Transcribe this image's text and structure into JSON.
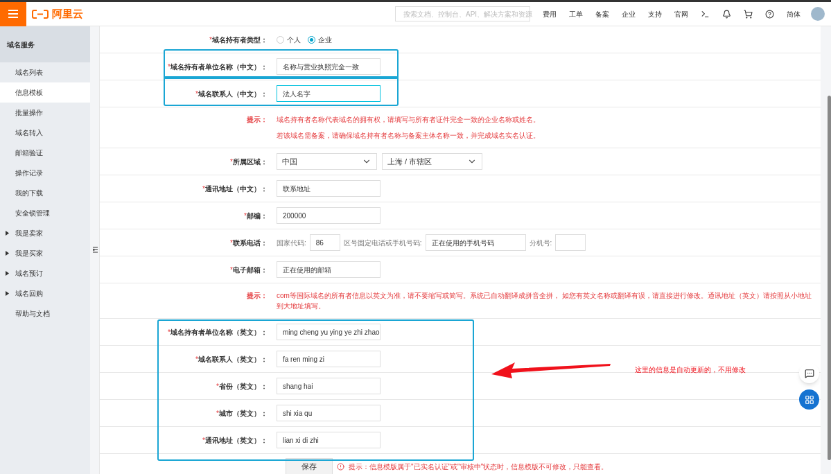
{
  "topbar": {
    "brand": "阿里云",
    "search": {
      "placeholder": "搜索文档、控制台、API、解决方案和资源"
    },
    "links": [
      "费用",
      "工单",
      "备案",
      "企业",
      "支持",
      "官网"
    ],
    "language": "简体"
  },
  "sidebar": {
    "header": "域名服务",
    "items": [
      {
        "label": "域名列表",
        "kind": "link",
        "selected": false
      },
      {
        "label": "信息模板",
        "kind": "link",
        "selected": true
      },
      {
        "label": "批量操作",
        "kind": "link",
        "selected": false
      },
      {
        "label": "域名转入",
        "kind": "link",
        "selected": false
      },
      {
        "label": "邮箱验证",
        "kind": "link",
        "selected": false
      },
      {
        "label": "操作记录",
        "kind": "link",
        "selected": false
      },
      {
        "label": "我的下载",
        "kind": "link",
        "selected": false
      },
      {
        "label": "安全锁管理",
        "kind": "link",
        "selected": false
      },
      {
        "label": "我是卖家",
        "kind": "group",
        "selected": false,
        "expanded": false
      },
      {
        "label": "我是买家",
        "kind": "group",
        "selected": false,
        "expanded": false
      },
      {
        "label": "域名预订",
        "kind": "group",
        "selected": false,
        "expanded": false
      },
      {
        "label": "域名回购",
        "kind": "group",
        "selected": false,
        "expanded": false
      },
      {
        "label": "帮助与文档",
        "kind": "link",
        "selected": false
      }
    ]
  },
  "form": {
    "sections": [
      {
        "highlighted": false,
        "rows": [
          {
            "kind": "radio",
            "mark": "*",
            "label": "域名持有者类型：",
            "options": [
              {
                "label": "个人",
                "selected": false
              },
              {
                "label": "企业",
                "selected": true
              }
            ]
          }
        ]
      },
      {
        "highlighted": true,
        "rows": [
          {
            "kind": "text",
            "mark": "*",
            "label": "域名持有者单位名称（中文）：",
            "value": "名称与营业执照完全一致",
            "focused": false
          }
        ]
      },
      {
        "highlighted": true,
        "rows": [
          {
            "kind": "text",
            "mark": "*",
            "label": "域名联系人（中文）：",
            "value": "法人名字",
            "focused": true
          }
        ]
      },
      {
        "highlighted": false,
        "rows": [
          {
            "kind": "tip",
            "label": "提示：",
            "lines": [
              "域名持有者名称代表域名的拥有权，请填写与所有者证件完全一致的企业名称或姓名。",
              "若该域名需备案，请确保域名持有者名称与备案主体名称一致，并完成域名实名认证。"
            ]
          },
          {
            "kind": "select",
            "mark": "*",
            "label": "所属区域：",
            "selects": [
              "中国",
              "上海 / 市辖区"
            ]
          },
          {
            "kind": "text",
            "mark": "*",
            "label": "通讯地址（中文）：",
            "value": "联系地址",
            "focused": false
          },
          {
            "kind": "text",
            "mark": "*",
            "label": "邮编：",
            "value": "200000",
            "focused": false
          },
          {
            "kind": "phone",
            "mark": "*",
            "label": "联系电话：",
            "parts": [
              {
                "kind": "caption",
                "text": "国家代码:"
              },
              {
                "kind": "code_input",
                "text": "86"
              },
              {
                "kind": "caption",
                "text": "区号固定电话或手机号码:"
              },
              {
                "kind": "number_input",
                "text": "正在使用的手机号码"
              },
              {
                "kind": "caption",
                "text": "分机号:"
              },
              {
                "kind": "ext_input"
              }
            ]
          },
          {
            "kind": "text",
            "mark": "*",
            "label": "电子邮箱：",
            "value": "正在使用的邮箱",
            "focused": false
          },
          {
            "kind": "tip",
            "label": "提示：",
            "lines": [
              "com等国际域名的所有者信息以英文为准，请不要缩写或简写。系统已自动翻译成拼音全拼， 如您有英文名称或翻译有误，请直接进行修改。通讯地址（英文）请按照从小地址到大地址填写。"
            ]
          }
        ]
      },
      {
        "highlighted": true,
        "annotation": "这里的信息是自动更新的，不用修改",
        "rows": [
          {
            "kind": "text",
            "mark": "*",
            "label": "域名持有者单位名称（英文）：",
            "value": "ming cheng yu ying ye zhi zhao",
            "focused": false
          },
          {
            "kind": "text",
            "mark": "*",
            "label": "域名联系人（英文）：",
            "value": "fa ren ming zi",
            "focused": false
          },
          {
            "kind": "text",
            "mark": "*",
            "label": "省份（英文）：",
            "value": "shang hai",
            "focused": false
          },
          {
            "kind": "text",
            "mark": "*",
            "label": "城市（英文）：",
            "value": "shi xia qu",
            "focused": false
          },
          {
            "kind": "text",
            "mark": "*",
            "label": "通讯地址（英文）：",
            "value": "lian xi di zhi",
            "focused": false
          }
        ]
      }
    ],
    "save": {
      "button": "保存",
      "notice": "提示：信息模版属于\"已实名认证\"或\"审核中\"状态时，信息模版不可修改，只能查看。"
    }
  }
}
